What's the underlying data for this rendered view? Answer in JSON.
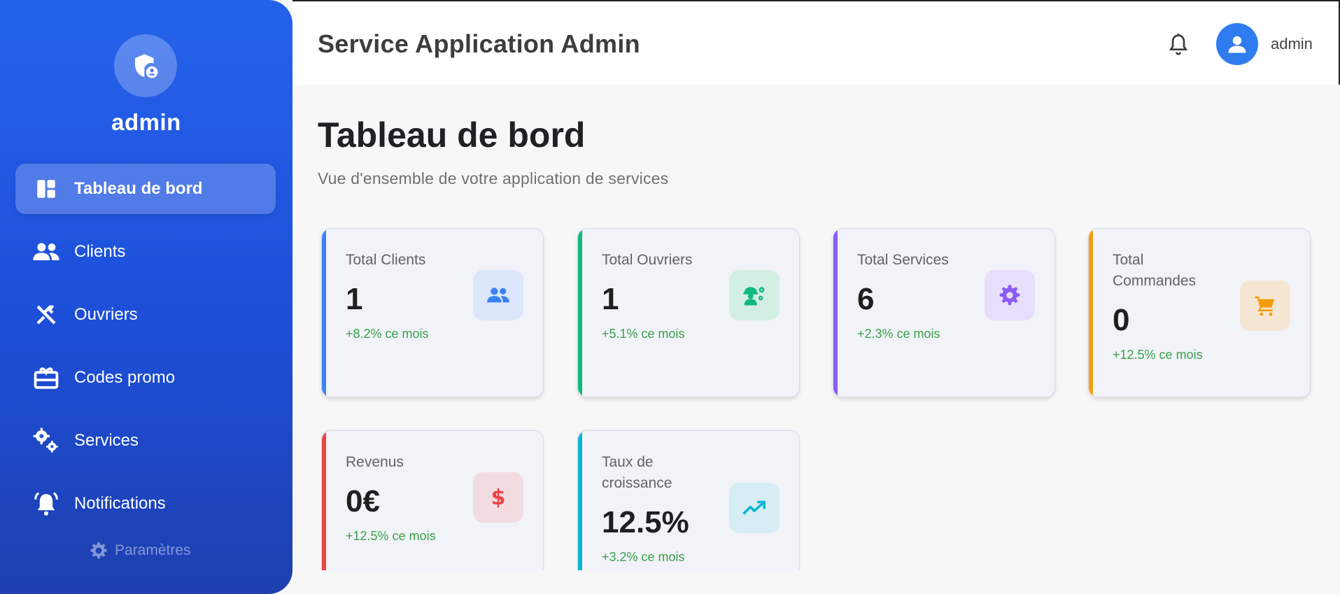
{
  "sidebar": {
    "username": "admin",
    "items": [
      {
        "label": "Tableau de bord",
        "icon": "dashboard-icon",
        "active": true
      },
      {
        "label": "Clients",
        "icon": "people-icon"
      },
      {
        "label": "Ouvriers",
        "icon": "tools-icon"
      },
      {
        "label": "Codes promo",
        "icon": "gift-card-icon"
      },
      {
        "label": "Services",
        "icon": "gears-icon"
      },
      {
        "label": "Notifications",
        "icon": "bell-ring-icon"
      }
    ],
    "settings_label": "Paramètres"
  },
  "header": {
    "title": "Service Application Admin",
    "username": "admin"
  },
  "main": {
    "title": "Tableau de bord",
    "subtitle": "Vue d'ensemble de votre application de services",
    "cards": [
      {
        "label": "Total Clients",
        "value": "1",
        "trend": "+8.2% ce mois",
        "accent": "#3b82f6",
        "icon": "people-icon"
      },
      {
        "label": "Total Ouvriers",
        "value": "1",
        "trend": "+5.1% ce mois",
        "accent": "#10b981",
        "icon": "worker-gear-icon"
      },
      {
        "label": "Total Services",
        "value": "6",
        "trend": "+2.3% ce mois",
        "accent": "#8b5cf6",
        "icon": "gear-icon"
      },
      {
        "label": "Total Commandes",
        "value": "0",
        "trend": "+12.5% ce mois",
        "accent": "#f59e0b",
        "icon": "cart-icon"
      },
      {
        "label": "Revenus",
        "value": "0€",
        "trend": "+12.5% ce mois",
        "accent": "#ef4444",
        "icon": "dollar-icon"
      },
      {
        "label": "Taux de croissance",
        "value": "12.5%",
        "trend": "+3.2% ce mois",
        "accent": "#06b6d4",
        "icon": "trending-up-icon"
      }
    ]
  }
}
